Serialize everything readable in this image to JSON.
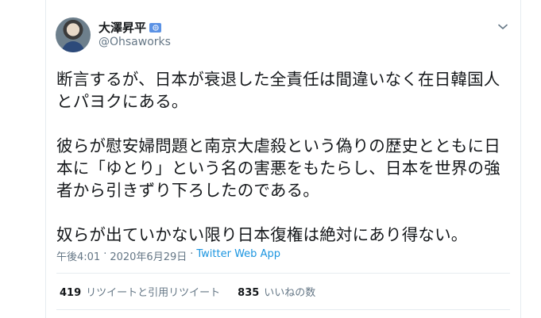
{
  "tweet": {
    "display_name": "大澤昇平",
    "handle": "@Ohsaworks",
    "text": "断言するが、日本が衰退した全責任は間違いなく在日韓国人\nとパヨクにある。\n\n彼らが慰安婦問題と南京大虐殺という偽りの歴史とともに日\n本に「ゆとり」という名の害悪をもたらし、日本を世界の強\n者から引きずり下ろしたのである。\n\n奴らが出ていかない限り日本復権は絶対にあり得ない。",
    "time": "午後4:01",
    "separator": "·",
    "date": "2020年6月29日",
    "source": "Twitter Web App"
  },
  "stats": {
    "retweets_count": "419",
    "retweets_label": "リツイートと引用リツイート",
    "likes_count": "835",
    "likes_label": "いいねの数"
  },
  "icons": {
    "badge": "un-flag-icon",
    "menu": "chevron-down-icon"
  },
  "colors": {
    "link": "#1b95e0",
    "secondary_text": "#657786",
    "primary_text": "#14171a",
    "badge_blue": "#5b92e5"
  }
}
